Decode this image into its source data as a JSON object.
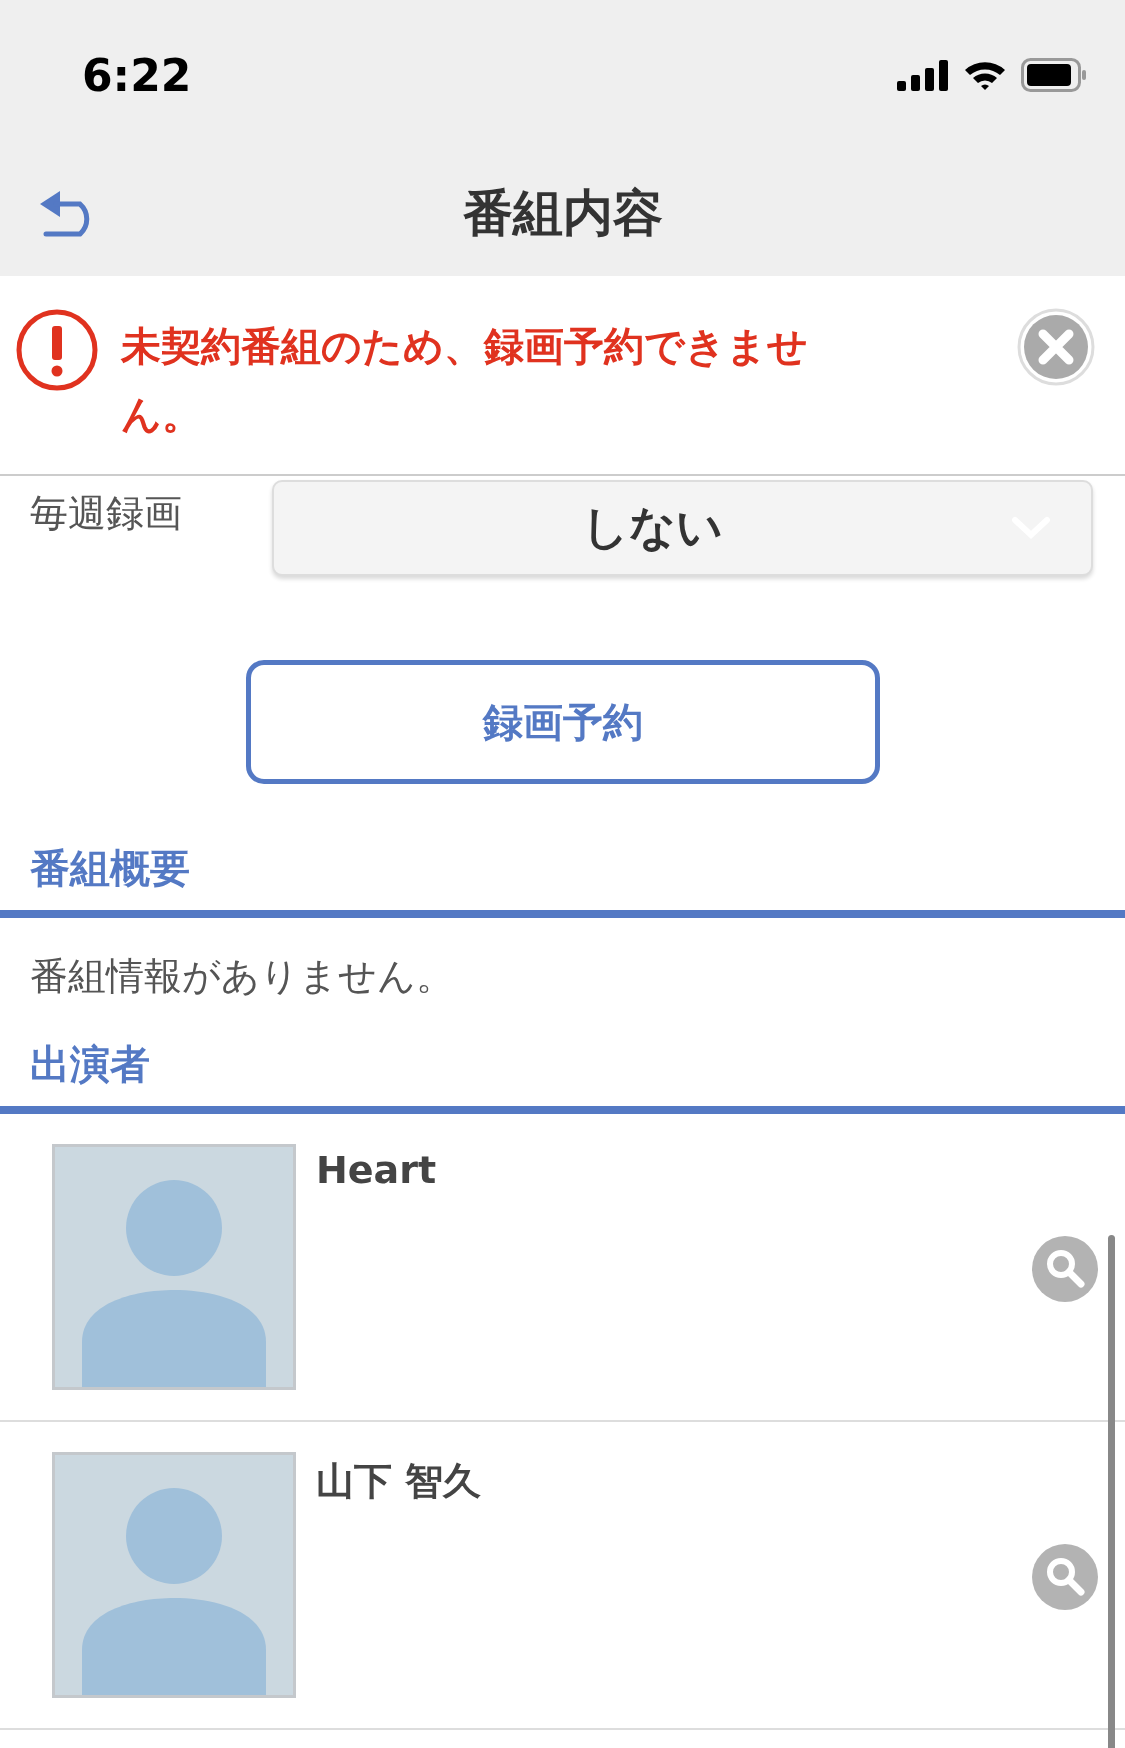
{
  "status_bar": {
    "time": "6:22"
  },
  "nav": {
    "title": "番組内容"
  },
  "alert": {
    "message": "未契約番組のため、録画予約できません。"
  },
  "weekly": {
    "label": "毎週録画",
    "value": "しない"
  },
  "record_button": "録画予約",
  "sections": [
    {
      "title": "番組概要",
      "body": "番組情報がありません。"
    },
    {
      "title": "出演者"
    }
  ],
  "cast": [
    {
      "name": "Heart"
    },
    {
      "name": "山下 智久"
    }
  ]
}
